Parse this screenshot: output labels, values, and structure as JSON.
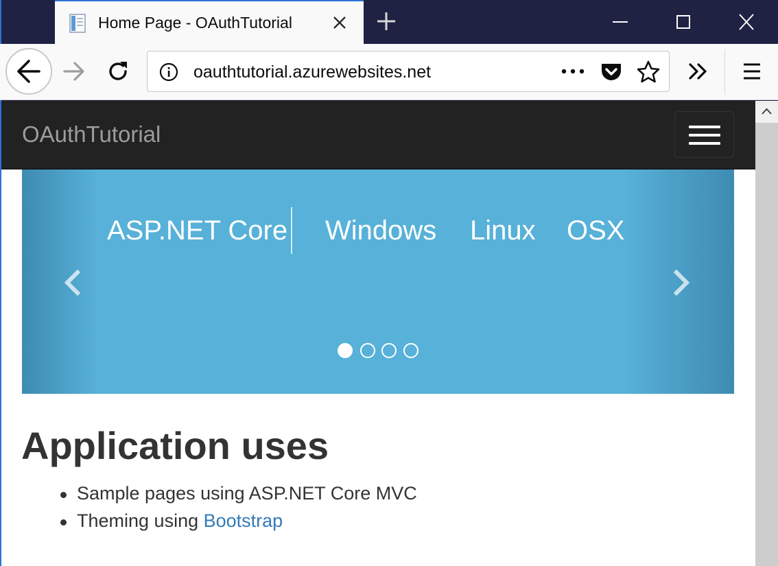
{
  "browser": {
    "tab_title": "Home Page - OAuthTutorial",
    "url": "oauthtutorial.azurewebsites.net",
    "accent_color": "#2a73d6",
    "icons": [
      "page-favicon-icon",
      "close-tab-icon",
      "new-tab-icon",
      "minimize-icon",
      "maximize-icon",
      "close-window-icon",
      "back-arrow-icon",
      "forward-arrow-icon",
      "reload-icon",
      "site-info-icon",
      "page-actions-icon",
      "pocket-icon",
      "bookmark-star-icon",
      "toolbar-overflow-icon",
      "hamburger-menu-icon",
      "scroll-up-arrow-icon"
    ]
  },
  "site": {
    "brand": "OAuthTutorial",
    "navbar_color": "#222222",
    "carousel": {
      "background_color": "#57b1d8",
      "items": [
        "ASP.NET Core",
        "Windows",
        "Linux",
        "OSX"
      ],
      "slide_count": 4,
      "active_slide": 1
    },
    "heading": "Application uses",
    "list": {
      "item1": "Sample pages using ASP.NET Core MVC",
      "item2_prefix": "Theming using ",
      "item2_link": "Bootstrap"
    },
    "link_color": "#337ab7"
  }
}
